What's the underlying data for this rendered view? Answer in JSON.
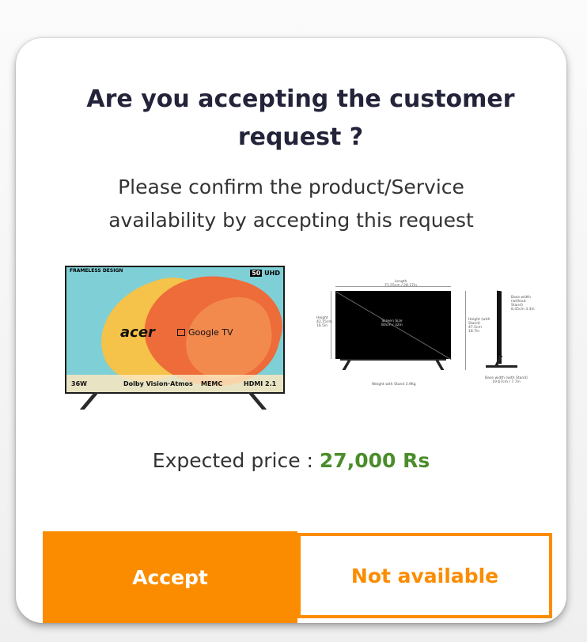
{
  "dialog": {
    "title": "Are you accepting the customer request ?",
    "message": "Please confirm the product/Service availability by accepting this request",
    "price_label": "Expected price : ",
    "price_value": "27,000 Rs",
    "accept_label": "Accept",
    "not_available_label": "Not available"
  },
  "product_image": {
    "frameless_text": "FRAMELESS DESIGN",
    "size_badge": "50",
    "uhd_text": "UHD",
    "brand": "acer",
    "platform": "Google TV",
    "features": [
      "36W",
      "Dolby Vision·Atmos",
      "MEMC",
      "HDMI 2.1"
    ]
  },
  "dimension_image": {
    "length_label": "Length",
    "length_value": "71.55cm / 28.17in",
    "height_label": "Height",
    "height_value": "42.15cm 16.5in",
    "screen_label": "Screen Size",
    "screen_value": "80cm / 32in",
    "height_with_stand_label": "Height (with Stand)",
    "height_with_stand_value": "47.5cm 18.7in",
    "base_width_label": "Base width (without Stand)",
    "base_width_value": "8.45cm 3.3in",
    "base_width_stand_label": "Base width (with Stand)",
    "base_width_stand_value": "19.67cm / 7.7in",
    "weight_label": "Weight with Stand 3.9Kg"
  },
  "colors": {
    "accent": "#fb8c00",
    "price": "#4a8d2b",
    "title": "#23233a"
  }
}
